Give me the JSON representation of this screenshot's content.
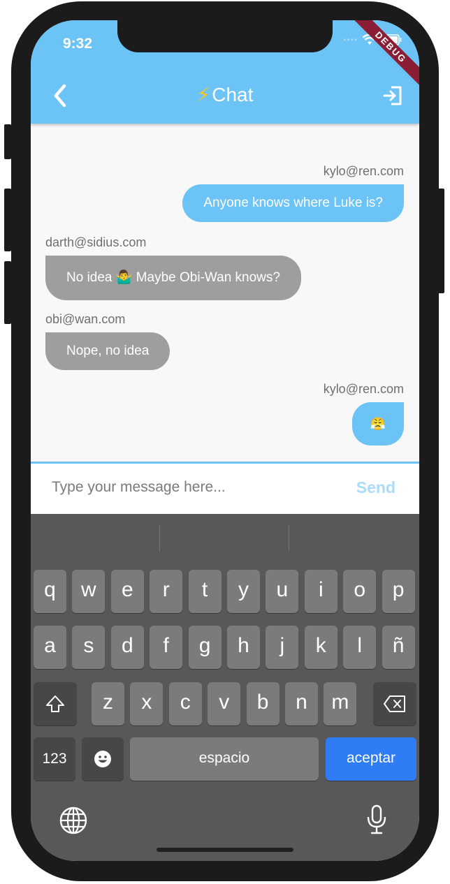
{
  "status_bar": {
    "time": "9:32",
    "debug_banner": "DEBUG"
  },
  "header": {
    "title_emoji": "⚡",
    "title": "Chat",
    "back_icon": "chevron-left-icon",
    "logout_icon": "logout-icon"
  },
  "messages": [
    {
      "sender": "kylo@ren.com",
      "text": "Anyone knows where Luke is?",
      "is_me": true
    },
    {
      "sender": "darth@sidius.com",
      "text": "No idea 🤷‍♂️ Maybe Obi-Wan knows?",
      "is_me": false
    },
    {
      "sender": "obi@wan.com",
      "text": "Nope, no idea",
      "is_me": false
    },
    {
      "sender": "kylo@ren.com",
      "text": "😤",
      "is_me": true
    }
  ],
  "composer": {
    "placeholder": "Type your message here...",
    "send_label": "Send"
  },
  "keyboard": {
    "row1": [
      "q",
      "w",
      "e",
      "r",
      "t",
      "y",
      "u",
      "i",
      "o",
      "p"
    ],
    "row2": [
      "a",
      "s",
      "d",
      "f",
      "g",
      "h",
      "j",
      "k",
      "l",
      "ñ"
    ],
    "row3": [
      "z",
      "x",
      "c",
      "v",
      "b",
      "n",
      "m"
    ],
    "numbers_label": "123",
    "space_label": "espacio",
    "return_label": "aceptar",
    "emoji_icon": "emoji-icon",
    "shift_icon": "shift-icon",
    "delete_icon": "backspace-icon",
    "globe_icon": "globe-icon",
    "mic_icon": "microphone-icon"
  },
  "colors": {
    "accent": "#6cc3f5",
    "other_bubble": "#9e9e9e",
    "return_key": "#2f7cf4"
  }
}
